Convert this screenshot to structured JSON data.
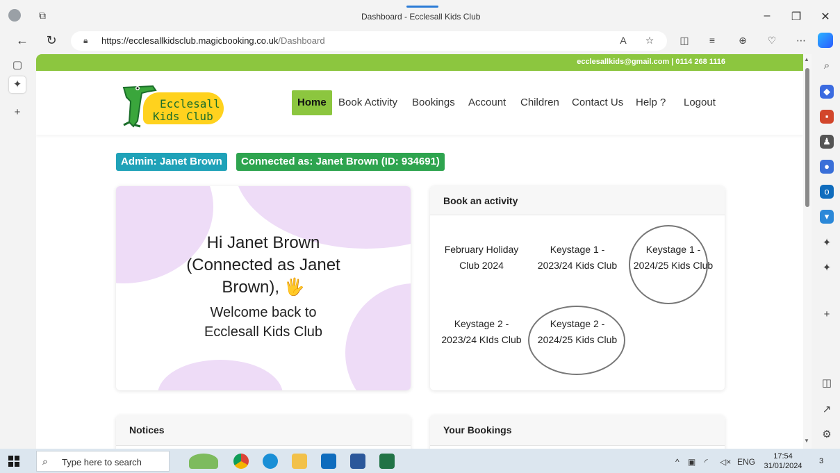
{
  "browser": {
    "tab_title": "Dashboard - Ecclesall Kids Club",
    "url_host": "https://ecclesallkidsclub.magicbooking.co.uk",
    "url_path": "/Dashboard"
  },
  "site": {
    "contact": "ecclesallkids@gmail.com | 0114 268 1116",
    "logo_line1": "Ecclesall",
    "logo_line2": "Kids Club",
    "nav": [
      {
        "label": "Home"
      },
      {
        "label": "Book Activity"
      },
      {
        "label": "Bookings"
      },
      {
        "label": "Account"
      },
      {
        "label": "Children"
      },
      {
        "label": "Contact Us"
      },
      {
        "label": "Help"
      },
      {
        "label": "Logout"
      }
    ],
    "admin_badge": "Admin: Janet Brown",
    "connected_badge": "Connected as: Janet Brown (ID: 934691)"
  },
  "welcome": {
    "greeting": "Hi Janet Brown (Connected as Janet Brown),",
    "wave": "🖐",
    "message": "Welcome back to Ecclesall Kids Club"
  },
  "book_activity": {
    "title": "Book an activity",
    "activities": [
      {
        "label": "February Holiday Club 2024",
        "circled": false
      },
      {
        "label": "Keystage 1 - 2023/24 Kids Club",
        "circled": false
      },
      {
        "label": "Keystage 1 - 2024/25 Kids Club",
        "circled": true
      },
      {
        "label": "Keystage 2 - 2023/24 KIds Club",
        "circled": false
      },
      {
        "label": "Keystage 2 - 2024/25 Kids Club",
        "circled": true
      }
    ]
  },
  "notices": {
    "title": "Notices"
  },
  "your_bookings": {
    "title": "Your Bookings"
  },
  "taskbar": {
    "search_placeholder": "Type here to search",
    "lang": "ENG",
    "time": "17:54",
    "date": "31/01/2024",
    "notifications": "3"
  },
  "colors": {
    "brand_green": "#8cc63f",
    "admin_teal": "#1fa2b8",
    "connected_green": "#2ea44f"
  }
}
